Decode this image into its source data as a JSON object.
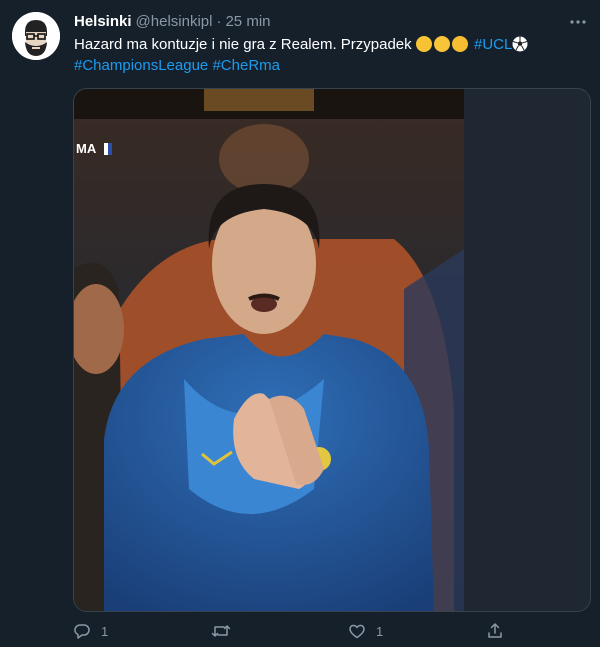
{
  "tweet": {
    "author_name": "Helsinki",
    "author_handle": "@helsinkipl",
    "separator": "·",
    "time": "25 min",
    "text_main": "Hazard ma kontuzje i nie gra z Realem. Przypadek ",
    "hashtag_ucl": "#UCL",
    "hashtag_champions": "#ChampionsLeague",
    "hashtag_match": "#CheRma",
    "emojis": [
      "thinking-face-emoji",
      "grinning-sweat-emoji",
      "tears-of-joy-emoji",
      "soccer-ball-emoji"
    ],
    "media_overlay_text": "MA"
  },
  "actions": {
    "reply_count": "1",
    "retweet_count": "",
    "like_count": "1"
  },
  "icons": [
    "more-icon",
    "reply-icon",
    "retweet-icon",
    "like-icon",
    "share-icon"
  ],
  "colors": {
    "background": "#15202b",
    "link": "#1d9bf0",
    "muted": "#8b98a5",
    "border": "#38444d"
  }
}
